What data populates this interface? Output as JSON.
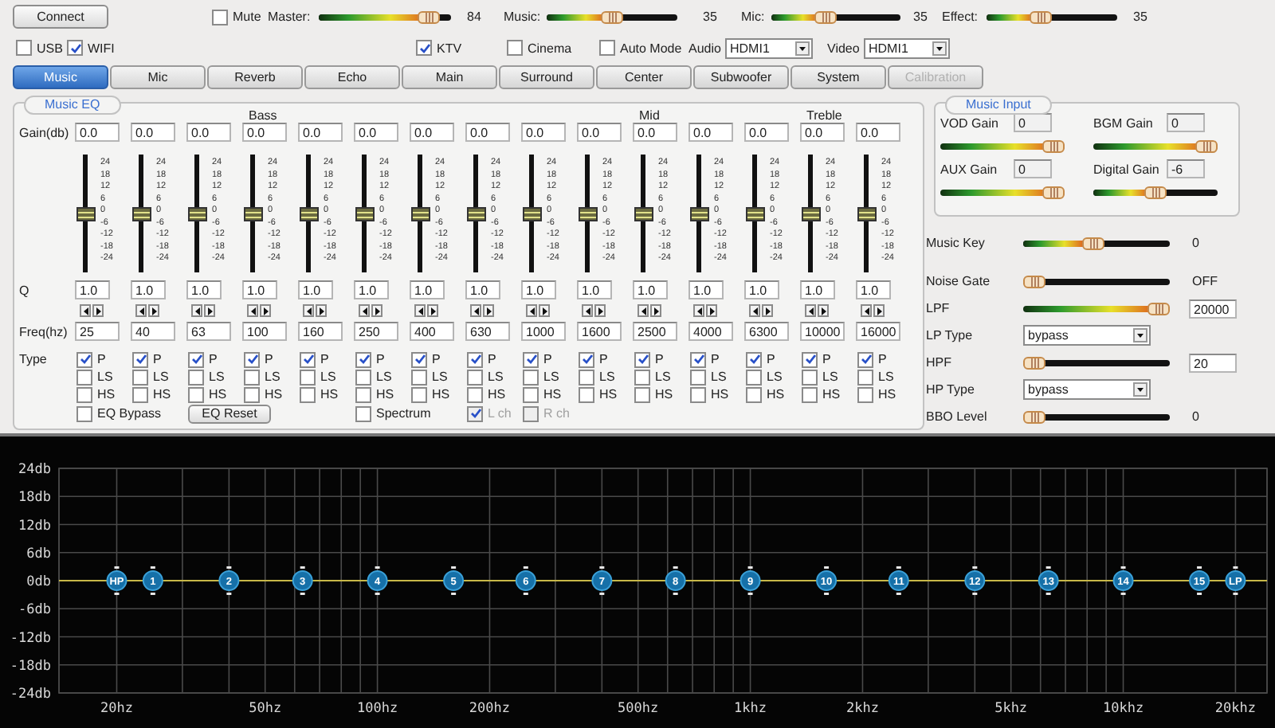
{
  "top": {
    "connect": "Connect",
    "mute": {
      "label": "Mute",
      "checked": false
    },
    "levels": [
      {
        "label": "Master:",
        "level": 0.9,
        "reading": "84"
      },
      {
        "label": "Music:",
        "level": 0.5,
        "reading": "35"
      },
      {
        "label": "Mic:",
        "level": 0.41,
        "reading": "35"
      },
      {
        "label": "Effect:",
        "level": 0.4,
        "reading": "35"
      }
    ],
    "links": [
      {
        "label": "USB",
        "checked": false
      },
      {
        "label": "WIFI",
        "checked": true
      }
    ],
    "modes": [
      {
        "label": "KTV",
        "checked": true
      },
      {
        "label": "Cinema",
        "checked": false
      },
      {
        "label": "Auto Mode",
        "checked": false
      }
    ],
    "selects": [
      {
        "label": "Audio",
        "value": "HDMI1"
      },
      {
        "label": "Video",
        "value": "HDMI1"
      }
    ]
  },
  "tabs": [
    {
      "label": "Music",
      "selected": true,
      "disabled": false
    },
    {
      "label": "Mic",
      "selected": false,
      "disabled": false
    },
    {
      "label": "Reverb",
      "selected": false,
      "disabled": false
    },
    {
      "label": "Echo",
      "selected": false,
      "disabled": false
    },
    {
      "label": "Main",
      "selected": false,
      "disabled": false
    },
    {
      "label": "Surround",
      "selected": false,
      "disabled": false
    },
    {
      "label": "Center",
      "selected": false,
      "disabled": false
    },
    {
      "label": "Subwoofer",
      "selected": false,
      "disabled": false
    },
    {
      "label": "System",
      "selected": false,
      "disabled": false
    },
    {
      "label": "Calibration",
      "selected": false,
      "disabled": true
    }
  ],
  "music_eq": {
    "title": "Music EQ",
    "row_labels": [
      "Gain(db)",
      "Q",
      "Freq(hz)",
      "Type"
    ],
    "bands": [
      {
        "gain": "0.0",
        "level": 0.5,
        "scale": [
          "24",
          "18",
          "12",
          "6",
          "0",
          "-6",
          "-12",
          "-18",
          "-24"
        ],
        "q": "1.0",
        "freq": "25",
        "types": [
          {
            "label": "P",
            "checked": true
          },
          {
            "label": "LS",
            "checked": false
          },
          {
            "label": "HS",
            "checked": false
          }
        ]
      },
      {
        "gain": "0.0",
        "level": 0.5,
        "scale": [
          "24",
          "18",
          "12",
          "6",
          "0",
          "-6",
          "-12",
          "-18",
          "-24"
        ],
        "q": "1.0",
        "freq": "40",
        "types": [
          {
            "label": "P",
            "checked": true
          },
          {
            "label": "LS",
            "checked": false
          },
          {
            "label": "HS",
            "checked": false
          }
        ]
      },
      {
        "gain": "0.0",
        "level": 0.5,
        "scale": [
          "24",
          "18",
          "12",
          "6",
          "0",
          "-6",
          "-12",
          "-18",
          "-24"
        ],
        "q": "1.0",
        "freq": "63",
        "types": [
          {
            "label": "P",
            "checked": true
          },
          {
            "label": "LS",
            "checked": false
          },
          {
            "label": "HS",
            "checked": false
          }
        ]
      },
      {
        "heading": "Bass",
        "gain": "0.0",
        "level": 0.5,
        "scale": [
          "24",
          "18",
          "12",
          "6",
          "0",
          "-6",
          "-12",
          "-18",
          "-24"
        ],
        "q": "1.0",
        "freq": "100",
        "types": [
          {
            "label": "P",
            "checked": true
          },
          {
            "label": "LS",
            "checked": false
          },
          {
            "label": "HS",
            "checked": false
          }
        ]
      },
      {
        "gain": "0.0",
        "level": 0.5,
        "scale": [
          "24",
          "18",
          "12",
          "6",
          "0",
          "-6",
          "-12",
          "-18",
          "-24"
        ],
        "q": "1.0",
        "freq": "160",
        "types": [
          {
            "label": "P",
            "checked": true
          },
          {
            "label": "LS",
            "checked": false
          },
          {
            "label": "HS",
            "checked": false
          }
        ]
      },
      {
        "gain": "0.0",
        "level": 0.5,
        "scale": [
          "24",
          "18",
          "12",
          "6",
          "0",
          "-6",
          "-12",
          "-18",
          "-24"
        ],
        "q": "1.0",
        "freq": "250",
        "types": [
          {
            "label": "P",
            "checked": true
          },
          {
            "label": "LS",
            "checked": false
          },
          {
            "label": "HS",
            "checked": false
          }
        ]
      },
      {
        "gain": "0.0",
        "level": 0.5,
        "scale": [
          "24",
          "18",
          "12",
          "6",
          "0",
          "-6",
          "-12",
          "-18",
          "-24"
        ],
        "q": "1.0",
        "freq": "400",
        "types": [
          {
            "label": "P",
            "checked": true
          },
          {
            "label": "LS",
            "checked": false
          },
          {
            "label": "HS",
            "checked": false
          }
        ]
      },
      {
        "gain": "0.0",
        "level": 0.5,
        "scale": [
          "24",
          "18",
          "12",
          "6",
          "0",
          "-6",
          "-12",
          "-18",
          "-24"
        ],
        "q": "1.0",
        "freq": "630",
        "types": [
          {
            "label": "P",
            "checked": true
          },
          {
            "label": "LS",
            "checked": false
          },
          {
            "label": "HS",
            "checked": false
          }
        ]
      },
      {
        "gain": "0.0",
        "level": 0.5,
        "scale": [
          "24",
          "18",
          "12",
          "6",
          "0",
          "-6",
          "-12",
          "-18",
          "-24"
        ],
        "q": "1.0",
        "freq": "1000",
        "types": [
          {
            "label": "P",
            "checked": true
          },
          {
            "label": "LS",
            "checked": false
          },
          {
            "label": "HS",
            "checked": false
          }
        ]
      },
      {
        "gain": "0.0",
        "level": 0.5,
        "scale": [
          "24",
          "18",
          "12",
          "6",
          "0",
          "-6",
          "-12",
          "-18",
          "-24"
        ],
        "q": "1.0",
        "freq": "1600",
        "types": [
          {
            "label": "P",
            "checked": true
          },
          {
            "label": "LS",
            "checked": false
          },
          {
            "label": "HS",
            "checked": false
          }
        ]
      },
      {
        "heading": "Mid",
        "gain": "0.0",
        "level": 0.5,
        "scale": [
          "24",
          "18",
          "12",
          "6",
          "0",
          "-6",
          "-12",
          "-18",
          "-24"
        ],
        "q": "1.0",
        "freq": "2500",
        "types": [
          {
            "label": "P",
            "checked": true
          },
          {
            "label": "LS",
            "checked": false
          },
          {
            "label": "HS",
            "checked": false
          }
        ]
      },
      {
        "gain": "0.0",
        "level": 0.5,
        "scale": [
          "24",
          "18",
          "12",
          "6",
          "0",
          "-6",
          "-12",
          "-18",
          "-24"
        ],
        "q": "1.0",
        "freq": "4000",
        "types": [
          {
            "label": "P",
            "checked": true
          },
          {
            "label": "LS",
            "checked": false
          },
          {
            "label": "HS",
            "checked": false
          }
        ]
      },
      {
        "gain": "0.0",
        "level": 0.5,
        "scale": [
          "24",
          "18",
          "12",
          "6",
          "0",
          "-6",
          "-12",
          "-18",
          "-24"
        ],
        "q": "1.0",
        "freq": "6300",
        "types": [
          {
            "label": "P",
            "checked": true
          },
          {
            "label": "LS",
            "checked": false
          },
          {
            "label": "HS",
            "checked": false
          }
        ]
      },
      {
        "heading": "Treble",
        "gain": "0.0",
        "level": 0.5,
        "scale": [
          "24",
          "18",
          "12",
          "6",
          "0",
          "-6",
          "-12",
          "-18",
          "-24"
        ],
        "q": "1.0",
        "freq": "10000",
        "types": [
          {
            "label": "P",
            "checked": true
          },
          {
            "label": "LS",
            "checked": false
          },
          {
            "label": "HS",
            "checked": false
          }
        ]
      },
      {
        "gain": "0.0",
        "level": 0.5,
        "scale": [
          "24",
          "18",
          "12",
          "6",
          "0",
          "-6",
          "-12",
          "-18",
          "-24"
        ],
        "q": "1.0",
        "freq": "16000",
        "types": [
          {
            "label": "P",
            "checked": true
          },
          {
            "label": "LS",
            "checked": false
          },
          {
            "label": "HS",
            "checked": false
          }
        ]
      }
    ],
    "eq_bypass": {
      "label": "EQ Bypass",
      "checked": false
    },
    "eq_reset": "EQ Reset",
    "spectrum": {
      "label": "Spectrum",
      "checked": false
    },
    "channels": [
      {
        "label": "L ch",
        "checked": true,
        "disabled": true
      },
      {
        "label": "R ch",
        "checked": false,
        "disabled": true
      }
    ]
  },
  "music_input": {
    "title": "Music Input",
    "gains": [
      {
        "label": "VOD Gain",
        "value": "0",
        "level": 1
      },
      {
        "label": "BGM Gain",
        "value": "0",
        "level": 1
      },
      {
        "label": "AUX Gain",
        "value": "0",
        "level": 1
      },
      {
        "label": "Digital Gain",
        "value": "-6",
        "level": 0.5
      }
    ]
  },
  "controls": [
    {
      "kind": "reading",
      "label": "Music Key",
      "level": 0.47,
      "reading": "0"
    },
    {
      "kind": "reading",
      "label": "Noise Gate",
      "level": 0,
      "reading": "OFF"
    },
    {
      "kind": "field",
      "label": "LPF",
      "level": 1,
      "value": "20000"
    },
    {
      "kind": "select",
      "label": "LP Type",
      "value": "bypass"
    },
    {
      "kind": "field",
      "label": "HPF",
      "level": 0,
      "value": "20"
    },
    {
      "kind": "select",
      "label": "HP Type",
      "value": "bypass"
    },
    {
      "kind": "reading",
      "label": "BBO Level",
      "level": 0,
      "reading": "0"
    }
  ],
  "graph": {
    "y_labels": [
      "24db",
      "18db",
      "12db",
      "6db",
      "0db",
      "-6db",
      "-12db",
      "-18db",
      "-24db"
    ],
    "x_labels": [
      "20hz",
      "50hz",
      "100hz",
      "200hz",
      "500hz",
      "1khz",
      "2khz",
      "5khz",
      "10khz",
      "20khz"
    ],
    "handles": [
      {
        "kind": "hp",
        "label": "HP"
      },
      {
        "kind": "band",
        "label": "1"
      },
      {
        "kind": "band",
        "label": "2"
      },
      {
        "kind": "band",
        "label": "3"
      },
      {
        "kind": "band",
        "label": "4"
      },
      {
        "kind": "band",
        "label": "5"
      },
      {
        "kind": "band",
        "label": "6"
      },
      {
        "kind": "band",
        "label": "7"
      },
      {
        "kind": "band",
        "label": "8"
      },
      {
        "kind": "band",
        "label": "9"
      },
      {
        "kind": "band",
        "label": "10"
      },
      {
        "kind": "band",
        "label": "11"
      },
      {
        "kind": "band",
        "label": "12"
      },
      {
        "kind": "band",
        "label": "13"
      },
      {
        "kind": "band",
        "label": "14"
      },
      {
        "kind": "band",
        "label": "15"
      },
      {
        "kind": "lp",
        "label": "LP"
      }
    ]
  }
}
